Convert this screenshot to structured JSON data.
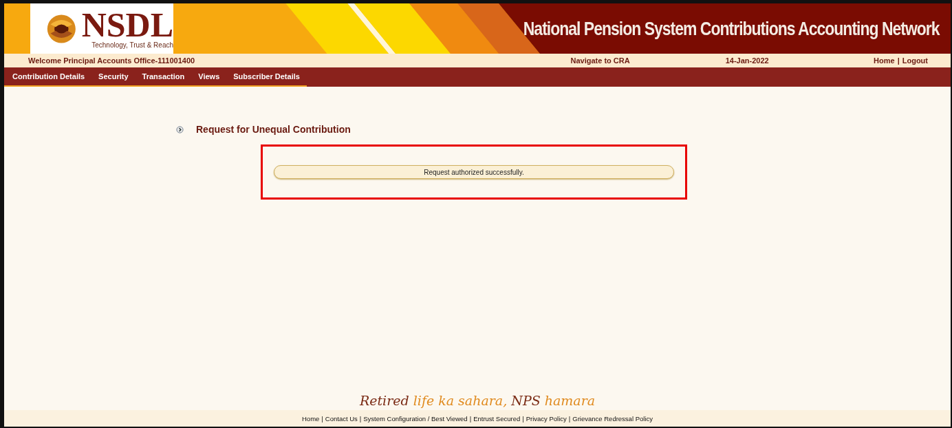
{
  "header": {
    "logo_text": "NSDL",
    "logo_tagline": "Technology, Trust & Reach",
    "title": "National Pension System Contributions Accounting Network"
  },
  "info_bar": {
    "welcome": "Welcome Principal Accounts Office-111001400",
    "navigate": "Navigate to CRA",
    "date": "14-Jan-2022",
    "links": [
      "Home",
      "Logout"
    ],
    "separator": "|"
  },
  "menu": [
    "Contribution Details",
    "Security",
    "Transaction",
    "Views",
    "Subscriber Details"
  ],
  "page_title": "Request for Unequal Contribution",
  "message": "Request authorized successfully.",
  "tagline": [
    {
      "text": "Retired",
      "color": "#7a2a14"
    },
    {
      "text": "life ka sahara,",
      "color": "#e08a1e"
    },
    {
      "text": "NPS",
      "color": "#7a2a14"
    },
    {
      "text": "hamara",
      "color": "#e08a1e"
    }
  ],
  "footer_links": [
    "Home",
    "Contact Us",
    "System Configuration / Best Viewed",
    "Entrust Secured",
    "Privacy Policy",
    "Grievance Redressal Policy"
  ]
}
